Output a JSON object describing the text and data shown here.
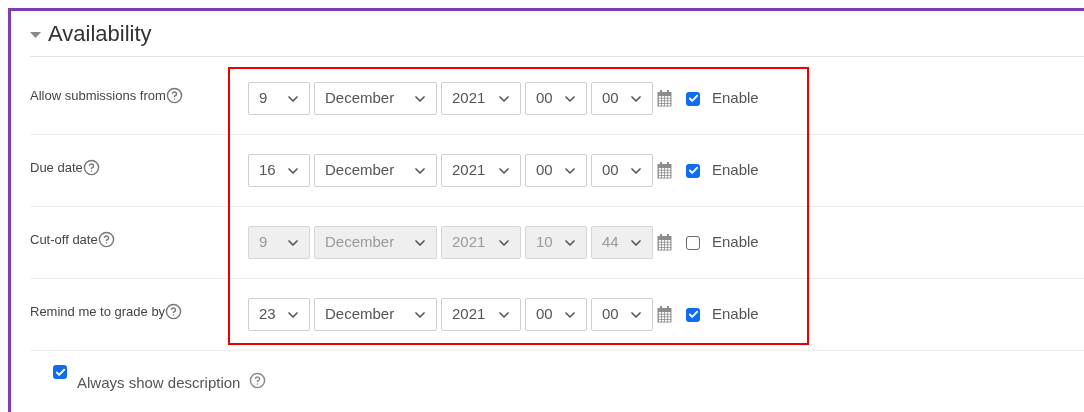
{
  "section": {
    "title": "Availability",
    "expanded": true
  },
  "date_rows": [
    {
      "label": "Allow submissions from",
      "day": "9",
      "month": "December",
      "year": "2021",
      "hour": "00",
      "minute": "00",
      "enabled": true,
      "enable_label": "Enable"
    },
    {
      "label": "Due date",
      "day": "16",
      "month": "December",
      "year": "2021",
      "hour": "00",
      "minute": "00",
      "enabled": true,
      "enable_label": "Enable"
    },
    {
      "label": "Cut-off date",
      "day": "9",
      "month": "December",
      "year": "2021",
      "hour": "10",
      "minute": "44",
      "enabled": false,
      "enable_label": "Enable"
    },
    {
      "label": "Remind me to grade by",
      "day": "23",
      "month": "December",
      "year": "2021",
      "hour": "00",
      "minute": "00",
      "enabled": true,
      "enable_label": "Enable"
    }
  ],
  "always_show_description": {
    "label": "Always show description",
    "checked": true
  }
}
